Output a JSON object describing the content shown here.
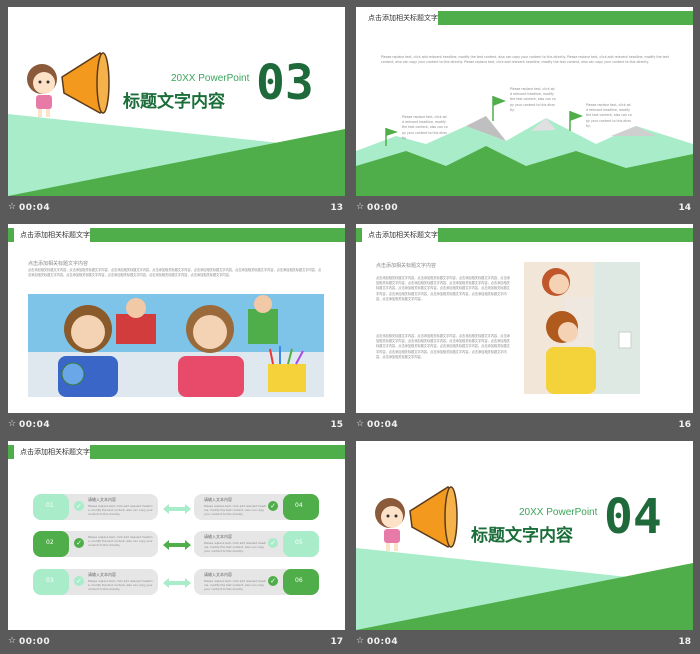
{
  "slides": [
    {
      "time": "00:04",
      "number": "13",
      "en_title": "20XX PowerPoint",
      "cn_title": "标题文字内容",
      "section_number": "03"
    },
    {
      "time": "00:00",
      "number": "14",
      "header": "点击添加相关标题文字",
      "body": "Please replace text, click add relevant headline, modify the text content, also can copy your content to this directly. Please replace text, click add relevant headline, modify the text content, also can copy your content to this directly. Please replace text, click add relevant headline, modify the text content, also can copy your content to this directly.",
      "flag_text_1": "Please replace text, click add relevant headline, modify the text content, also can copy your content to this directly.",
      "flag_text_2": "Please replace text, click add relevant headline, modify the text content, also can copy your content to this directly.",
      "flag_text_3": "Please replace text, click add relevant headline, modify the text content, also can copy your content to this directly."
    },
    {
      "time": "00:04",
      "number": "15",
      "header": "点击添加相关标题文字",
      "subtitle": "点击添加相关标题文字内容",
      "body": "点击添加相关标题文字内容，点击添加相关标题文字内容，点击添加相关标题文字内容，点击添加相关标题文字内容，点击添加相关标题文字内容，点击添加相关标题文字内容，点击添加相关标题文字内容，点击添加相关标题文字内容，点击添加相关标题文字内容，点击添加相关标题文字内容，点击添加相关标题文字内容，点击添加相关标题文字内容。"
    },
    {
      "time": "00:04",
      "number": "16",
      "header": "点击添加相关标题文字",
      "subtitle": "点击添加相关标题文字内容",
      "body1": "点击添加相关标题文字内容，点击添加相关标题文字内容，点击添加相关标题文字内容，点击添加相关标题文字内容，点击添加相关标题文字内容，点击添加相关标题文字内容，点击添加相关标题文字内容，点击添加相关标题文字内容，点击添加相关标题文字内容，点击添加相关标题文字内容，点击添加相关标题文字内容，点击添加相关标题文字内容，点击添加相关标题文字内容，点击添加相关标题文字内容。",
      "body2": "点击添加相关标题文字内容，点击添加相关标题文字内容，点击添加相关标题文字内容，点击添加相关标题文字内容，点击添加相关标题文字内容，点击添加相关标题文字内容，点击添加相关标题文字内容，点击添加相关标题文字内容，点击添加相关标题文字内容，点击添加相关标题文字内容，点击添加相关标题文字内容，点击添加相关标题文字内容，点击添加相关标题文字内容，点击添加相关标题文字内容。"
    },
    {
      "time": "00:00",
      "number": "17",
      "header": "点击添加相关标题文字",
      "items": [
        {
          "num": "01",
          "title": "请输入文本内容",
          "text": "Please replace text, click add relevant headline, modify the text content, also can copy your content to this directly."
        },
        {
          "num": "02",
          "title": "请输入文本内容",
          "text": "Please replace text, click add relevant headline, modify the text content, also can copy your content to this directly."
        },
        {
          "num": "03",
          "title": "请输入文本内容",
          "text": "Please replace text, click add relevant headline, modify the text content, also can copy your content to this directly."
        },
        {
          "num": "04",
          "title": "请输入文本内容",
          "text": "Please replace text, click add relevant headline, modify the text content, also can copy your content to this directly."
        },
        {
          "num": "05",
          "title": "请输入文本内容",
          "text": "Please replace text, click add relevant headline, modify the text content, also can copy your content to this directly."
        },
        {
          "num": "06",
          "title": "请输入文本内容",
          "text": "Please replace text, click add relevant headline, modify the text content, also can copy your content to this directly."
        }
      ]
    },
    {
      "time": "00:04",
      "number": "18",
      "en_title": "20XX PowerPoint",
      "cn_title": "标题文字内容",
      "section_number": "04"
    }
  ],
  "star_icon": "☆",
  "colors": {
    "green": "#4fae4a",
    "light_green": "#a8ecc9",
    "dark_green": "#1f6a3a",
    "bg": "#5a5a5a"
  }
}
